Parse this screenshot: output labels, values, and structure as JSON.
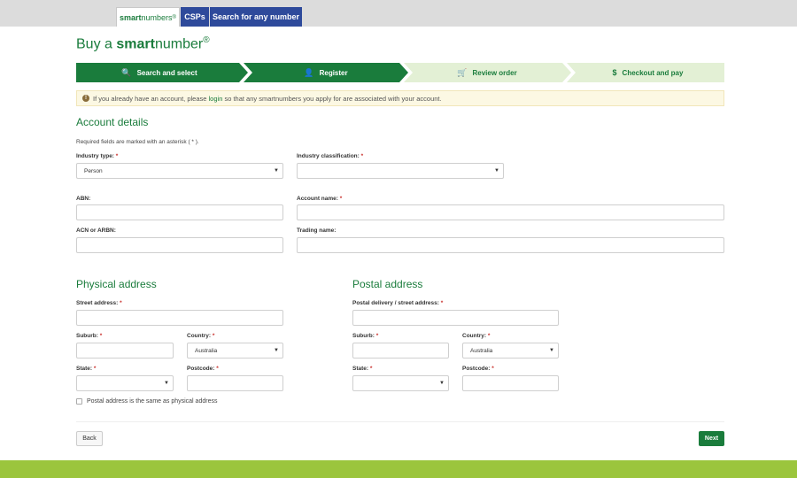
{
  "tabs": {
    "brand_strong": "smart",
    "brand_light": "numbers",
    "brand_mark": "®",
    "csps": "CSPs",
    "search": "Search for any number"
  },
  "page": {
    "title_prefix": "Buy a ",
    "title_strong": "smart",
    "title_suffix": "number",
    "title_mark": "®"
  },
  "steps": [
    {
      "label": "Search and select",
      "icon": "search-icon",
      "glyph": "🔍",
      "state": "active"
    },
    {
      "label": "Register",
      "icon": "user-icon",
      "glyph": "👤",
      "state": "active"
    },
    {
      "label": "Review order",
      "icon": "cart-icon",
      "glyph": "🛒",
      "state": "inactive"
    },
    {
      "label": "Checkout and pay",
      "icon": "dollar-icon",
      "glyph": "$",
      "state": "inactive"
    }
  ],
  "alert": {
    "icon": "exclamation-icon",
    "before": "If you already have an account, please ",
    "link": "login",
    "after": " so that any smartnumbers you apply for are associated with your account."
  },
  "account": {
    "heading": "Account details",
    "note": "Required fields are marked with an asterisk ( * ).",
    "industry_type_label": "Industry type:",
    "industry_type_value": "Person",
    "industry_class_label": "Industry classification:",
    "industry_class_value": "",
    "abn_label": "ABN:",
    "account_name_label": "Account name:",
    "acn_label": "ACN or ARBN:",
    "trading_name_label": "Trading name:"
  },
  "physical": {
    "heading": "Physical address",
    "street_label": "Street address:",
    "suburb_label": "Suburb:",
    "country_label": "Country:",
    "country_value": "Australia",
    "state_label": "State:",
    "state_value": "",
    "postcode_label": "Postcode:"
  },
  "postal": {
    "heading": "Postal address",
    "street_label": "Postal delivery / street address:",
    "suburb_label": "Suburb:",
    "country_label": "Country:",
    "country_value": "Australia",
    "state_label": "State:",
    "state_value": "",
    "postcode_label": "Postcode:"
  },
  "same_as_physical": "Postal address is the same as physical address",
  "buttons": {
    "back": "Back",
    "next": "Next"
  },
  "colors": {
    "brand_green": "#1a7c3c",
    "tab_blue": "#2e4a9b",
    "footer_green": "#9bc53d"
  },
  "asterisk": "*"
}
